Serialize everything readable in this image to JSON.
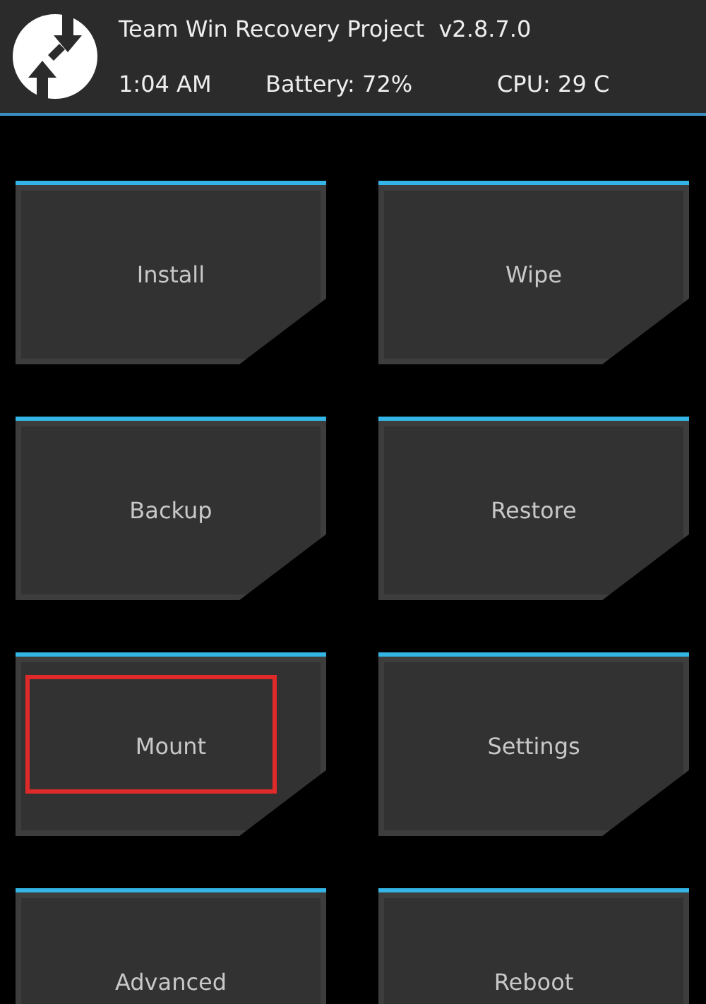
{
  "header": {
    "title": "Team Win Recovery Project  v2.8.7.0",
    "time": "1:04 AM",
    "battery": "Battery: 72%",
    "cpu": "CPU: 29 C"
  },
  "buttons": [
    {
      "label": "Install",
      "highlighted": false
    },
    {
      "label": "Wipe",
      "highlighted": false
    },
    {
      "label": "Backup",
      "highlighted": false
    },
    {
      "label": "Restore",
      "highlighted": false
    },
    {
      "label": "Mount",
      "highlighted": true
    },
    {
      "label": "Settings",
      "highlighted": false
    },
    {
      "label": "Advanced",
      "highlighted": false
    },
    {
      "label": "Reboot",
      "highlighted": false
    }
  ]
}
